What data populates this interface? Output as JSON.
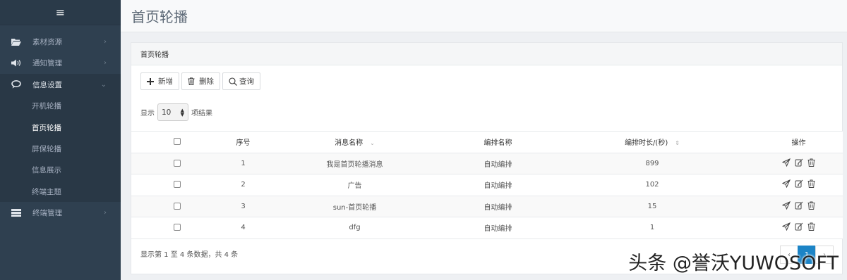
{
  "sidebar": {
    "toggle_icon": "menu-icon",
    "items": [
      {
        "label": "素材资源",
        "icon": "folder-open-icon",
        "chevron": "›"
      },
      {
        "label": "通知管理",
        "icon": "volume-icon",
        "chevron": "›"
      },
      {
        "label": "信息设置",
        "icon": "chat-bubble-icon",
        "chevron": "⌄"
      },
      {
        "label": "终端管理",
        "icon": "server-icon",
        "chevron": "›"
      }
    ],
    "sub_items": [
      "开机轮播",
      "首页轮播",
      "屏保轮播",
      "信息展示",
      "终端主题"
    ]
  },
  "page": {
    "title": "首页轮播"
  },
  "panel": {
    "title": "首页轮播"
  },
  "toolbar": {
    "add_label": "新增",
    "delete_label": "删除",
    "query_label": "查询"
  },
  "pagesize": {
    "prefix": "显示",
    "value": "10",
    "suffix": "项结果"
  },
  "table": {
    "headers": [
      "",
      "序号",
      "消息名称",
      "编排名称",
      "编排时长/(秒)",
      "操作"
    ],
    "rows": [
      {
        "no": "1",
        "name": "我是首页轮播消息",
        "arrange": "自动编排",
        "duration": "899"
      },
      {
        "no": "2",
        "name": "广告",
        "arrange": "自动编排",
        "duration": "102"
      },
      {
        "no": "3",
        "name": "sun-首页轮播",
        "arrange": "自动编排",
        "duration": "15"
      },
      {
        "no": "4",
        "name": "dfg",
        "arrange": "自动编排",
        "duration": "1"
      }
    ]
  },
  "footer": {
    "info": "显示第 1 至 4 条数据，共 4 条"
  },
  "pager": {
    "prev": "‹",
    "current": "1",
    "next": "›"
  },
  "watermark": "头条 @誉沃YUWOSOFT",
  "colors": {
    "sidebar_bg": "#2f4050",
    "accent": "#1c84c6"
  }
}
